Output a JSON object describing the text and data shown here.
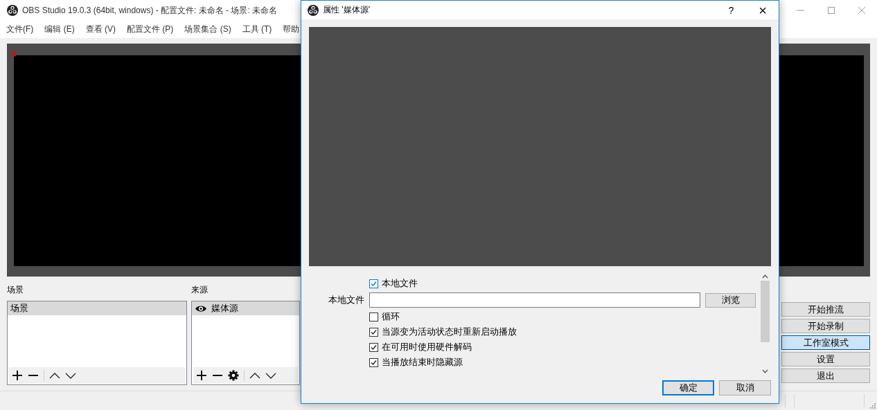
{
  "main_window": {
    "title": "OBS Studio 19.0.3 (64bit, windows) - 配置文件: 未命名 - 场景: 未命名",
    "menu": [
      "文件(F)",
      "编辑 (E)",
      "查看 (V)",
      "配置文件 (P)",
      "场景集合 (S)",
      "工具 (T)",
      "帮助"
    ],
    "scenes": {
      "label": "场景",
      "items": [
        {
          "name": "场景",
          "selected": true
        }
      ]
    },
    "sources": {
      "label": "来源",
      "items": [
        {
          "name": "媒体源",
          "selected": true,
          "visible": true
        }
      ]
    },
    "controls": [
      {
        "label": "开始推流",
        "on": false
      },
      {
        "label": "开始录制",
        "on": false
      },
      {
        "label": "工作室模式",
        "on": true
      },
      {
        "label": "设置",
        "on": false
      },
      {
        "label": "退出",
        "on": false
      }
    ]
  },
  "dialog": {
    "title": "属性 '媒体源'",
    "help": "?",
    "close": "×",
    "fields": [
      {
        "kind": "checkbox",
        "label": "本地文件",
        "checked": true
      },
      {
        "kind": "file",
        "label": "本地文件",
        "button": "浏览"
      },
      {
        "kind": "checkbox",
        "label": "循环",
        "checked": false
      },
      {
        "kind": "checkbox",
        "label": "当源变为活动状态时重新启动播放",
        "checked": true
      },
      {
        "kind": "checkbox",
        "label": "在可用时使用硬件解码",
        "checked": true
      },
      {
        "kind": "checkbox",
        "label": "当播放结束时隐藏源",
        "checked": true
      }
    ],
    "buttons": [
      {
        "label": "确定",
        "default": true
      },
      {
        "label": "取消",
        "default": false
      }
    ]
  }
}
